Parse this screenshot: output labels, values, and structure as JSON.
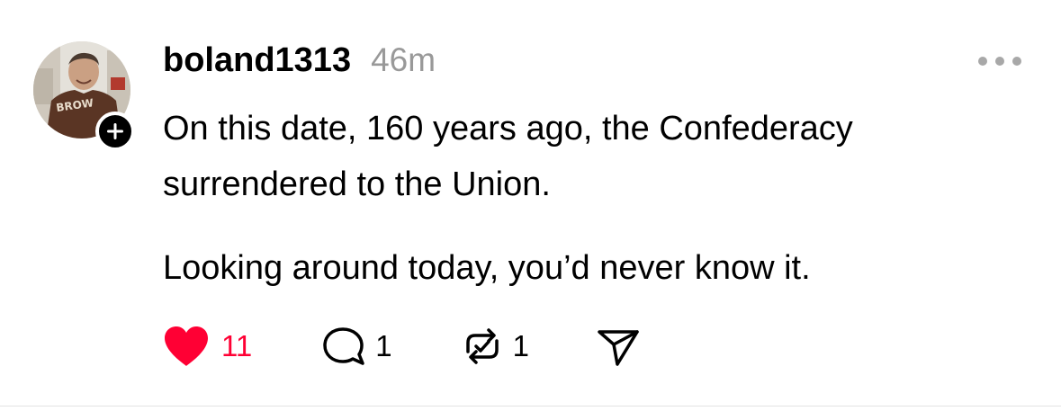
{
  "post": {
    "username": "boland1313",
    "time": "46m",
    "paragraphs": [
      "On this date, 160 years ago, the Confederacy surrendered to the Union.",
      "Looking around today, you’d never know it."
    ],
    "likes": "11",
    "replies": "1",
    "reposts": "1",
    "liked": true
  },
  "colors": {
    "like": "#ff0034",
    "muted": "#999999",
    "text": "#000000"
  },
  "icons": {
    "follow": "plus-icon",
    "more": "more-icon",
    "like": "heart-icon",
    "reply": "comment-bubble-icon",
    "repost": "repost-icon",
    "share": "send-icon"
  }
}
